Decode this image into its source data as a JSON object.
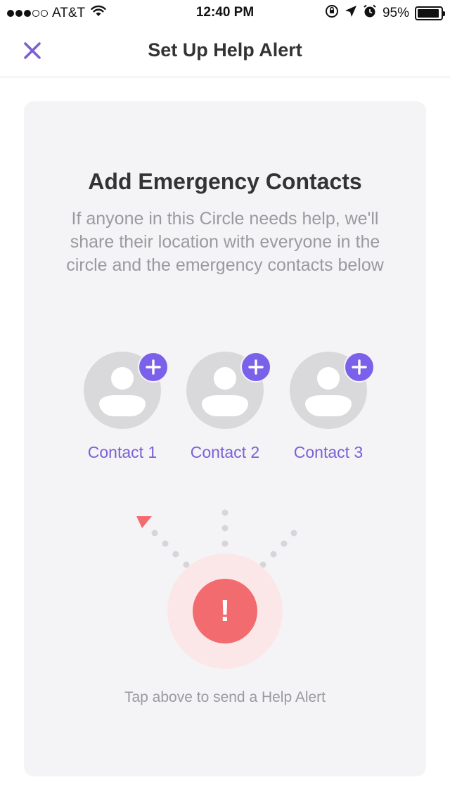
{
  "status_bar": {
    "carrier": "AT&T",
    "time": "12:40 PM",
    "battery": "95%",
    "battery_level": 0.95
  },
  "nav": {
    "title": "Set Up Help Alert"
  },
  "card": {
    "title": "Add Emergency Contacts",
    "description": "If anyone in this Circle needs help, we'll share their location with everyone in the circle and the emergency contacts below",
    "contacts": [
      {
        "label": "Contact 1"
      },
      {
        "label": "Contact 2"
      },
      {
        "label": "Contact 3"
      }
    ],
    "alert_symbol": "!",
    "hint": "Tap above to send a Help Alert"
  },
  "colors": {
    "accent": "#7b61ea",
    "alert": "#f26b6f"
  }
}
